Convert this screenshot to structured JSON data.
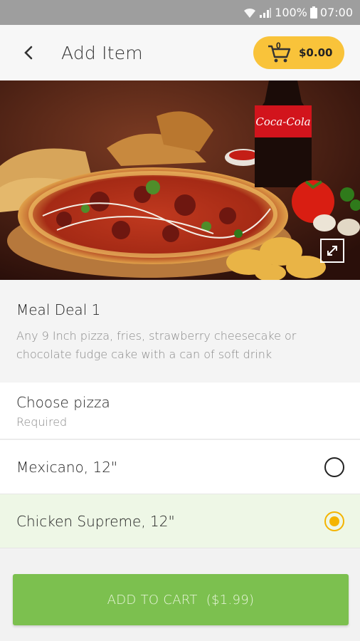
{
  "status_bar": {
    "battery": "100%",
    "time": "07:00"
  },
  "header": {
    "title": "Add Item",
    "cart_count": "0",
    "cart_total": "$0.00"
  },
  "item": {
    "name": "Meal Deal 1",
    "description": "Any 9 Inch pizza, fries, strawberry cheesecake or chocolate fudge cake with a can of soft drink",
    "image_brand_text": "Coca-Cola"
  },
  "choice_group": {
    "title": "Choose pizza",
    "subtitle": "Required",
    "options": [
      {
        "label": "Mexicano, 12\"",
        "selected": false
      },
      {
        "label": "Chicken Supreme, 12\"",
        "selected": true
      }
    ]
  },
  "footer": {
    "add_to_cart_label": "ADD TO CART",
    "price_label": "($1.99)"
  },
  "colors": {
    "accent": "#f9c33a",
    "selected_row": "#eef7e6",
    "cta": "#7cc04f",
    "radio_on": "#f4b400"
  }
}
